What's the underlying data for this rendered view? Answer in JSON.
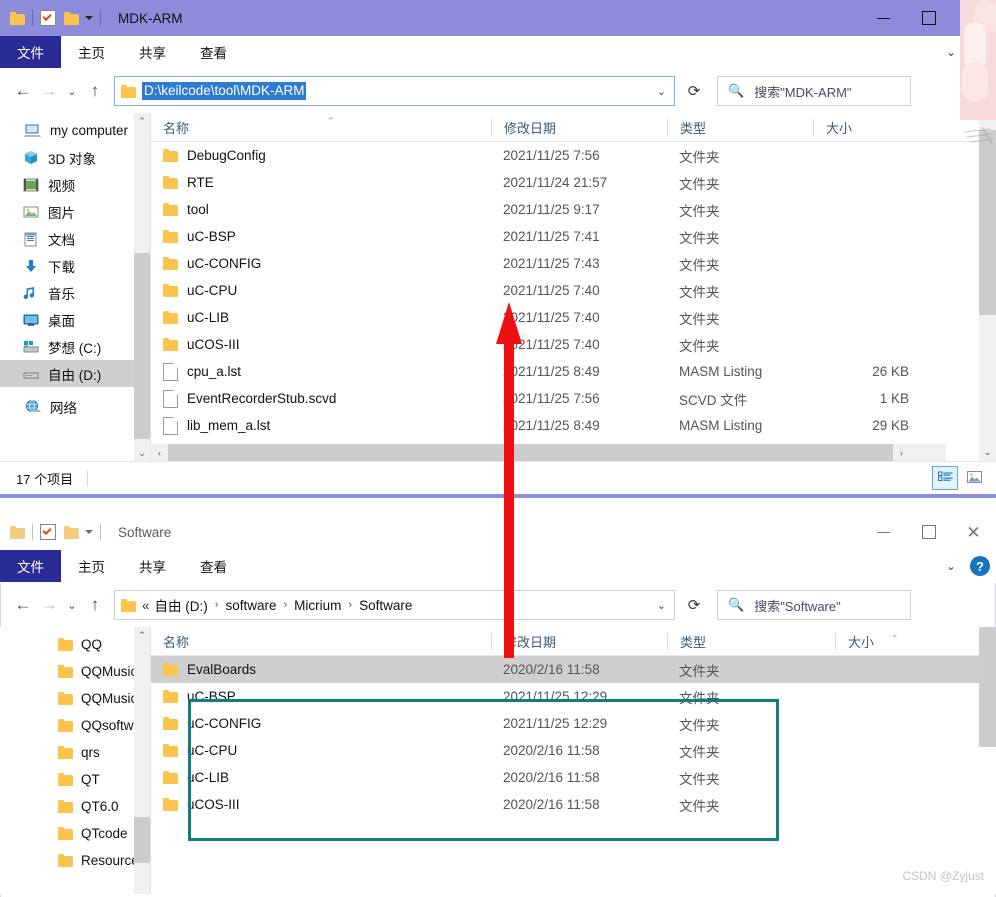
{
  "window1": {
    "title": "MDK-ARM",
    "ribbon_tabs": [
      "文件",
      "主页",
      "共享",
      "查看"
    ],
    "address": "D:\\keilcode\\tool\\MDK-ARM",
    "search_placeholder": "搜索\"MDK-ARM\"",
    "refresh_icon": "refresh-icon",
    "nav_items": [
      {
        "label": "my computer",
        "icon": "computer-icon",
        "selected": false
      },
      {
        "label": "3D 对象",
        "icon": "3d-objects-icon",
        "selected": false
      },
      {
        "label": "视频",
        "icon": "videos-icon",
        "selected": false
      },
      {
        "label": "图片",
        "icon": "pictures-icon",
        "selected": false
      },
      {
        "label": "文档",
        "icon": "documents-icon",
        "selected": false
      },
      {
        "label": "下载",
        "icon": "downloads-icon",
        "selected": false
      },
      {
        "label": "音乐",
        "icon": "music-icon",
        "selected": false
      },
      {
        "label": "桌面",
        "icon": "desktop-icon",
        "selected": false
      },
      {
        "label": "梦想 (C:)",
        "icon": "windows-drive-icon",
        "selected": false
      },
      {
        "label": "自由 (D:)",
        "icon": "drive-icon",
        "selected": true
      },
      {
        "label": "网络",
        "icon": "network-icon",
        "selected": false
      }
    ],
    "columns": [
      "名称",
      "修改日期",
      "类型",
      "大小"
    ],
    "rows": [
      {
        "name": "DebugConfig",
        "date": "2021/11/25 7:56",
        "type": "文件夹",
        "size": "",
        "kind": "folder"
      },
      {
        "name": "RTE",
        "date": "2021/11/24 21:57",
        "type": "文件夹",
        "size": "",
        "kind": "folder"
      },
      {
        "name": "tool",
        "date": "2021/11/25 9:17",
        "type": "文件夹",
        "size": "",
        "kind": "folder"
      },
      {
        "name": "uC-BSP",
        "date": "2021/11/25 7:41",
        "type": "文件夹",
        "size": "",
        "kind": "folder"
      },
      {
        "name": "uC-CONFIG",
        "date": "2021/11/25 7:43",
        "type": "文件夹",
        "size": "",
        "kind": "folder"
      },
      {
        "name": "uC-CPU",
        "date": "2021/11/25 7:40",
        "type": "文件夹",
        "size": "",
        "kind": "folder"
      },
      {
        "name": "uC-LIB",
        "date": "2021/11/25 7:40",
        "type": "文件夹",
        "size": "",
        "kind": "folder"
      },
      {
        "name": "uCOS-III",
        "date": "2021/11/25 7:40",
        "type": "文件夹",
        "size": "",
        "kind": "folder"
      },
      {
        "name": "cpu_a.lst",
        "date": "2021/11/25 8:49",
        "type": "MASM Listing",
        "size": "26 KB",
        "kind": "file"
      },
      {
        "name": "EventRecorderStub.scvd",
        "date": "2021/11/25 7:56",
        "type": "SCVD 文件",
        "size": "1 KB",
        "kind": "file"
      },
      {
        "name": "lib_mem_a.lst",
        "date": "2021/11/25 8:49",
        "type": "MASM Listing",
        "size": "29 KB",
        "kind": "file"
      }
    ],
    "status": "17 个项目",
    "view_buttons": [
      "details-view-icon",
      "large-icons-view-icon"
    ]
  },
  "window2": {
    "title": "Software",
    "ribbon_tabs": [
      "文件",
      "主页",
      "共享",
      "查看"
    ],
    "breadcrumb": [
      "自由 (D:)",
      "software",
      "Micrium",
      "Software"
    ],
    "breadcrumb_prefix": "«",
    "search_placeholder": "搜索\"Software\"",
    "nav_items": [
      {
        "label": "QQ",
        "icon": "folder-icon"
      },
      {
        "label": "QQMusic",
        "icon": "folder-icon"
      },
      {
        "label": "QQMusicC",
        "icon": "folder-icon"
      },
      {
        "label": "QQsoftwa",
        "icon": "folder-icon"
      },
      {
        "label": "qrs",
        "icon": "folder-icon"
      },
      {
        "label": "QT",
        "icon": "folder-icon"
      },
      {
        "label": "QT6.0",
        "icon": "folder-icon"
      },
      {
        "label": "QTcode",
        "icon": "folder-icon"
      },
      {
        "label": "Resource.",
        "icon": "folder-icon"
      }
    ],
    "columns": [
      "名称",
      "修改日期",
      "类型",
      "大小"
    ],
    "rows": [
      {
        "name": "EvalBoards",
        "date": "2020/2/16 11:58",
        "type": "文件夹",
        "size": "",
        "selected": true
      },
      {
        "name": "uC-BSP",
        "date": "2021/11/25 12:29",
        "type": "文件夹",
        "size": "",
        "selected": false
      },
      {
        "name": "uC-CONFIG",
        "date": "2021/11/25 12:29",
        "type": "文件夹",
        "size": "",
        "selected": false
      },
      {
        "name": "uC-CPU",
        "date": "2020/2/16 11:58",
        "type": "文件夹",
        "size": "",
        "selected": false
      },
      {
        "name": "uC-LIB",
        "date": "2020/2/16 11:58",
        "type": "文件夹",
        "size": "",
        "selected": false
      },
      {
        "name": "uCOS-III",
        "date": "2020/2/16 11:58",
        "type": "文件夹",
        "size": "",
        "selected": false
      }
    ]
  },
  "annotations": {
    "highlight_color": "#0e7f7d",
    "arrow_color": "#ee1111",
    "arrow_name": "red-up-arrow"
  },
  "watermark": "CSDN @Zyjust",
  "theme": {
    "titlebar_active": "#8c8cda",
    "file_tab": "#2b2b96",
    "selection": "#cfcfcf",
    "address_selection": "#2f7bd1"
  }
}
